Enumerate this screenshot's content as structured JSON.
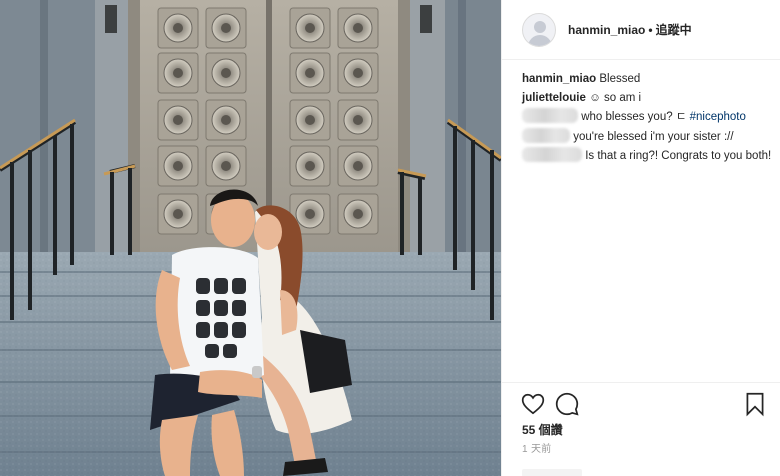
{
  "post": {
    "username": "hanmin_miao",
    "separator": "•",
    "follow_status": "追蹤中"
  },
  "comments": [
    {
      "user": "hanmin_miao",
      "text": "Blessed"
    },
    {
      "user": "juliettelouie",
      "text": "☺ so am i"
    },
    {
      "user_hidden": true,
      "text": "who blesses you? ㄷ ",
      "tag": "#nicephoto"
    },
    {
      "user_hidden": true,
      "text": "you're blessed i'm your sister ://"
    },
    {
      "user_hidden": true,
      "text": "Is that a ring?! Congrats to you both!"
    }
  ],
  "actions": {
    "like_icon": "heart-icon",
    "comment_icon": "comment-icon",
    "save_icon": "bookmark-icon"
  },
  "likes": "55 個讚",
  "time_ago": "1 天前",
  "colors": {
    "link": "#003569",
    "muted": "#999999",
    "text": "#262626",
    "border": "#efefef"
  }
}
